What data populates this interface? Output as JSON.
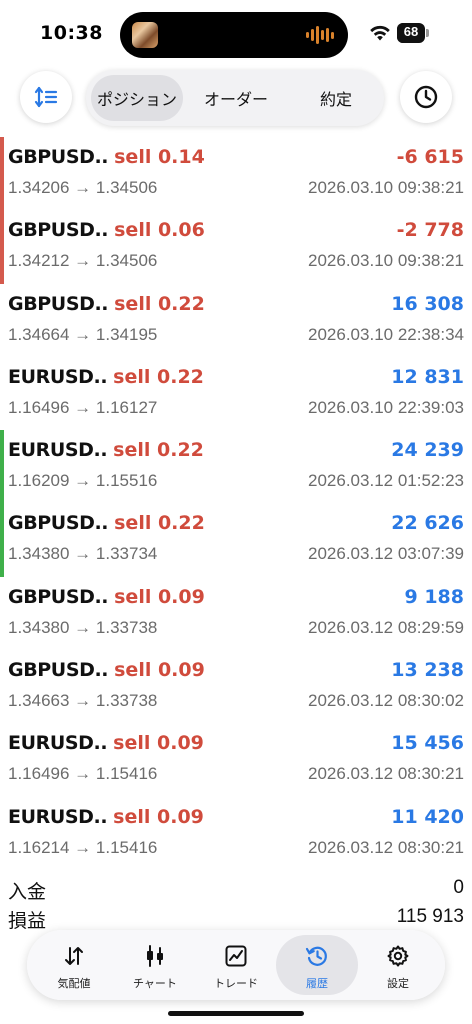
{
  "status_bar": {
    "time": "10:38",
    "battery_text": "68",
    "battery_level_pct": 68
  },
  "top": {
    "sort_icon": "sort-icon",
    "clock_icon": "clock-icon",
    "tabs": [
      {
        "label": "ポジション",
        "active": true
      },
      {
        "label": "オーダー",
        "active": false
      },
      {
        "label": "約定",
        "active": false
      }
    ]
  },
  "colors": {
    "sell": "#d04b3c",
    "loss": "#d04b3c",
    "profit": "#2a79e4",
    "bar_red": "#d45a4d",
    "bar_green": "#3fb04a",
    "accent": "#2a79e4"
  },
  "deals": [
    {
      "symbol": "GBPUSD..",
      "action": "sell 0.14",
      "profit": "-6 615",
      "prices": "1.34206 → 1.34506",
      "time": "2026.03.10 09:38:21",
      "result": "loss",
      "marker": "red"
    },
    {
      "symbol": "GBPUSD..",
      "action": "sell 0.06",
      "profit": "-2 778",
      "prices": "1.34212 → 1.34506",
      "time": "2026.03.10 09:38:21",
      "result": "loss",
      "marker": "red"
    },
    {
      "symbol": "GBPUSD..",
      "action": "sell 0.22",
      "profit": "16 308",
      "prices": "1.34664 → 1.34195",
      "time": "2026.03.10 22:38:34",
      "result": "profit",
      "marker": "none"
    },
    {
      "symbol": "EURUSD..",
      "action": "sell 0.22",
      "profit": "12 831",
      "prices": "1.16496 → 1.16127",
      "time": "2026.03.10 22:39:03",
      "result": "profit",
      "marker": "none"
    },
    {
      "symbol": "EURUSD..",
      "action": "sell 0.22",
      "profit": "24 239",
      "prices": "1.16209 → 1.15516",
      "time": "2026.03.12 01:52:23",
      "result": "profit",
      "marker": "green"
    },
    {
      "symbol": "GBPUSD..",
      "action": "sell 0.22",
      "profit": "22 626",
      "prices": "1.34380 → 1.33734",
      "time": "2026.03.12 03:07:39",
      "result": "profit",
      "marker": "green"
    },
    {
      "symbol": "GBPUSD..",
      "action": "sell 0.09",
      "profit": "9 188",
      "prices": "1.34380 → 1.33738",
      "time": "2026.03.12 08:29:59",
      "result": "profit",
      "marker": "none"
    },
    {
      "symbol": "GBPUSD..",
      "action": "sell 0.09",
      "profit": "13 238",
      "prices": "1.34663 → 1.33738",
      "time": "2026.03.12 08:30:02",
      "result": "profit",
      "marker": "none"
    },
    {
      "symbol": "EURUSD..",
      "action": "sell 0.09",
      "profit": "15 456",
      "prices": "1.16496 → 1.15416",
      "time": "2026.03.12 08:30:21",
      "result": "profit",
      "marker": "none"
    },
    {
      "symbol": "EURUSD..",
      "action": "sell 0.09",
      "profit": "11 420",
      "prices": "1.16214 → 1.15416",
      "time": "2026.03.12 08:30:21",
      "result": "profit",
      "marker": "none"
    }
  ],
  "summary": {
    "deposit_label": "入金",
    "deposit_value": "0",
    "pnl_label": "損益",
    "pnl_value": "115 913"
  },
  "tab_bar": {
    "items": [
      {
        "label": "気配値",
        "icon": "quotes-arrows-icon",
        "active": false
      },
      {
        "label": "チャート",
        "icon": "candlestick-icon",
        "active": false
      },
      {
        "label": "トレード",
        "icon": "trade-chart-icon",
        "active": false
      },
      {
        "label": "履歴",
        "icon": "history-clock-icon",
        "active": true
      },
      {
        "label": "設定",
        "icon": "gear-icon",
        "active": false
      }
    ]
  }
}
